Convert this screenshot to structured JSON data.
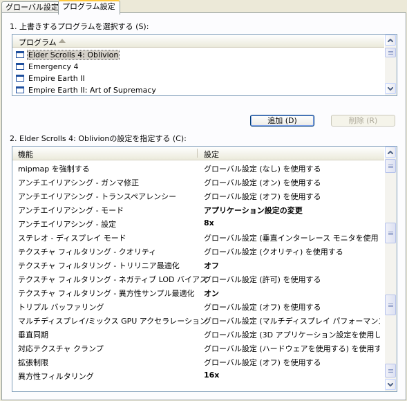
{
  "tabs": [
    {
      "label": "グローバル設定"
    },
    {
      "label": "プログラム設定"
    }
  ],
  "select_program": {
    "label": "1. 上書きするプログラムを選択する (S):",
    "column_header": "プログラム",
    "programs": [
      {
        "name": "Elder Scrolls 4: Oblivion"
      },
      {
        "name": "Emergency 4"
      },
      {
        "name": "Empire Earth II"
      },
      {
        "name": "Empire Earth II: Art of Supremacy"
      }
    ],
    "add_button": "追加 (D)",
    "remove_button": "削除 (R)"
  },
  "settings": {
    "label": "2. Elder Scrolls 4: Oblivionの設定を指定する (C):",
    "col_feature": "機能",
    "col_setting": "設定",
    "rows": [
      {
        "feature": "mipmap を強制する",
        "value": "グローバル設定 (なし) を使用する"
      },
      {
        "feature": "アンチエイリアシング - ガンマ修正",
        "value": "グローバル設定 (オン) を使用する"
      },
      {
        "feature": "アンチエイリアシング - トランスペアレンシー",
        "value": "グローバル設定 (オフ) を使用する"
      },
      {
        "feature": "アンチエイリアシング - モード",
        "value": "アプリケーション設定の変更"
      },
      {
        "feature": "アンチエイリアシング - 設定",
        "value": "8x"
      },
      {
        "feature": "ステレオ - ディスプレイ モード",
        "value": "グローバル設定 (垂直インターレース モニタを使用し..."
      },
      {
        "feature": "テクスチャ フィルタリング - クオリティ",
        "value": "グローバル設定 (クオリティ) を使用する"
      },
      {
        "feature": "テクスチャ フィルタリング - トリリニア最適化",
        "value": "オフ"
      },
      {
        "feature": "テクスチャ フィルタリング - ネガティブ LOD バイアス",
        "value": "グローバル設定 (許可) を使用する"
      },
      {
        "feature": "テクスチャ フィルタリング - 異方性サンプル最適化",
        "value": "オン"
      },
      {
        "feature": "トリプル バッファリング",
        "value": "グローバル設定 (オフ) を使用する"
      },
      {
        "feature": "マルチディスプレイ/ミックス GPU アクセラレーション",
        "value": "グローバル設定 (マルチディスプレイ パフォーマンス モ..."
      },
      {
        "feature": "垂直同期",
        "value": "グローバル設定 (3D アプリケーション設定を使用しま..."
      },
      {
        "feature": "対応テクスチャ クランプ",
        "value": "グローバル設定 (ハードウェアを使用する) を使用する"
      },
      {
        "feature": "拡張制限",
        "value": "グローバル設定 (オフ) を使用する"
      },
      {
        "feature": "異方性フィルタリング",
        "value": "16x"
      }
    ]
  }
}
